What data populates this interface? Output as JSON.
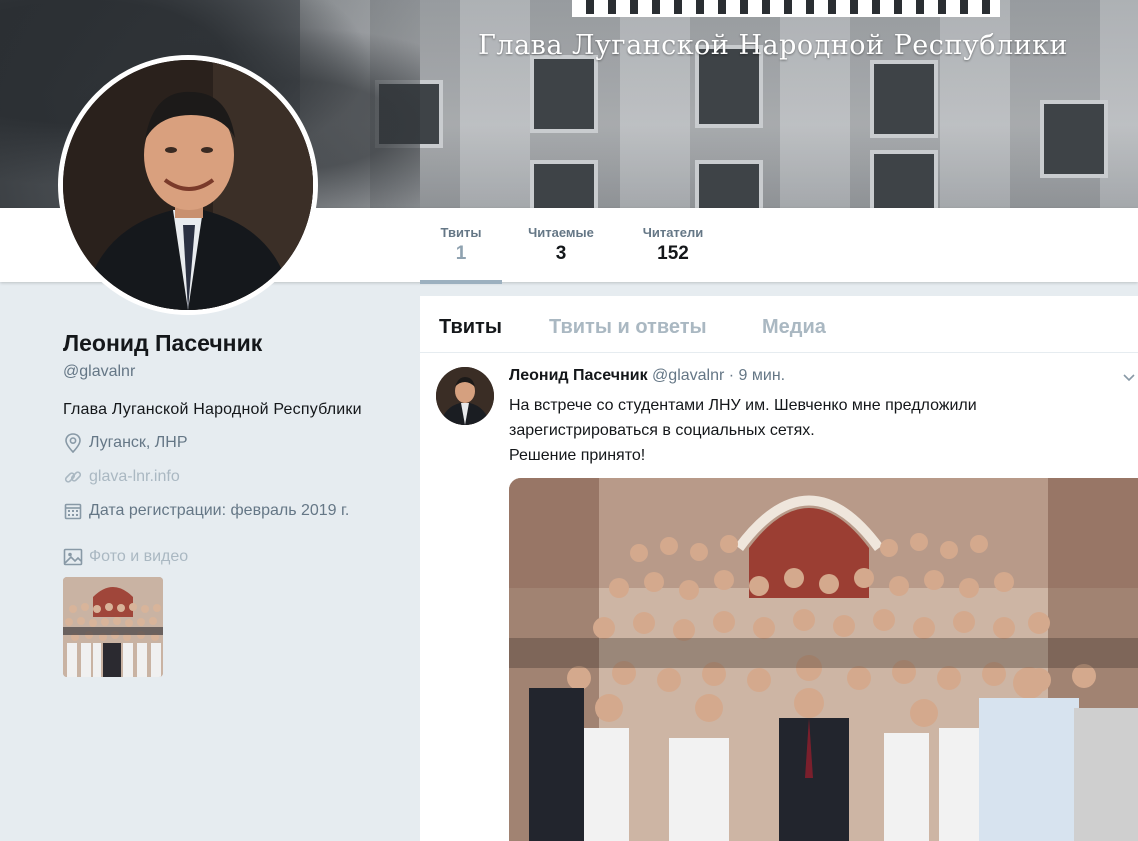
{
  "banner": {
    "title": "Глава Луганской Народной Республики"
  },
  "nav": {
    "stats": [
      {
        "label": "Твиты",
        "value": "1"
      },
      {
        "label": "Читаемые",
        "value": "3"
      },
      {
        "label": "Читатели",
        "value": "152"
      }
    ]
  },
  "profile": {
    "name": "Леонид Пасечник",
    "handle": "@glavalnr",
    "bio": "Глава Луганской Народной Республики",
    "location": "Луганск, ЛНР",
    "website": "glava-lnr.info",
    "joined": "Дата регистрации: февраль 2019 г.",
    "media_label": "Фото и видео"
  },
  "timeline": {
    "tabs": [
      "Твиты",
      "Твиты и ответы",
      "Медиа"
    ],
    "tweet": {
      "name": "Леонид Пасечник",
      "handle": "@glavalnr",
      "time": "· 9 мин.",
      "lines": [
        "На встрече со студентами ЛНУ им. Шевченко мне предложили",
        "зарегистрироваться в социальных сетях.",
        "Решение принято!"
      ]
    }
  },
  "icons": {
    "location": "location-pin-icon",
    "link": "link-icon",
    "calendar": "calendar-icon",
    "media": "image-icon",
    "caret": "chevron-down-icon"
  },
  "colors": {
    "background": "#e6ecf0",
    "secondary_text": "#657786",
    "muted_text": "#aab8c2",
    "active_underline": "#9cb0bf"
  }
}
